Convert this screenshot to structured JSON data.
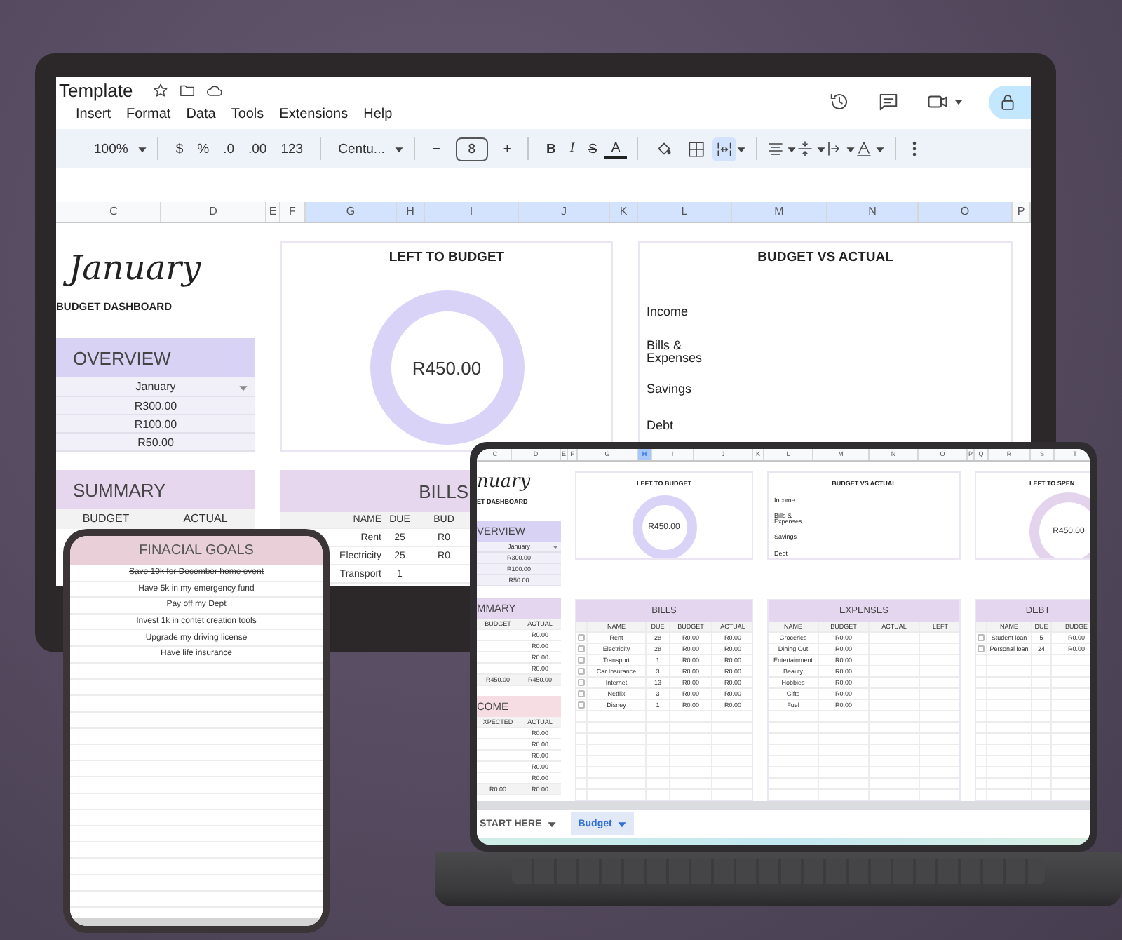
{
  "monitor": {
    "doc_title": "Template",
    "menu": [
      "Insert",
      "Format",
      "Data",
      "Tools",
      "Extensions",
      "Help"
    ],
    "toolbar": {
      "zoom": "100%",
      "currency": "$",
      "percent": "%",
      "fewer_decimals": ".0",
      "more_decimals": ".00",
      "number_format": "123",
      "font": "Centu...",
      "minus": "−",
      "font_size": "8",
      "plus": "+",
      "bold": "B",
      "italic": "I",
      "strikethrough": "S",
      "text_color": "A"
    },
    "columns": [
      {
        "label": "C",
        "selected": false
      },
      {
        "label": "D",
        "selected": false
      },
      {
        "label": "E",
        "selected": false
      },
      {
        "label": "F",
        "selected": false
      },
      {
        "label": "G",
        "selected": true
      },
      {
        "label": "H",
        "selected": true
      },
      {
        "label": "I",
        "selected": true
      },
      {
        "label": "J",
        "selected": true
      },
      {
        "label": "K",
        "selected": true
      },
      {
        "label": "L",
        "selected": true
      },
      {
        "label": "M",
        "selected": true
      },
      {
        "label": "N",
        "selected": true
      },
      {
        "label": "O",
        "selected": true
      },
      {
        "label": "P",
        "selected": false
      }
    ],
    "heading": "January",
    "subheading": "BUDGET DASHBOARD",
    "overview": {
      "title": "OVERVIEW",
      "month": "January",
      "values": [
        "R300.00",
        "R100.00",
        "R50.00"
      ]
    },
    "summary": {
      "title": "SUMMARY",
      "columns": [
        "BUDGET",
        "ACTUAL"
      ]
    },
    "left_to_budget": {
      "title": "LEFT TO BUDGET",
      "amount": "R450.00"
    },
    "budget_vs_actual": {
      "title": "BUDGET VS ACTUAL",
      "labels": [
        "Income",
        "Bills & Expenses",
        "Savings",
        "Debt"
      ]
    },
    "bills": {
      "title": "BILLS",
      "columns": [
        "NAME",
        "DUE",
        "BUD"
      ],
      "rows": [
        [
          "Rent",
          "25",
          "R0"
        ],
        [
          "Electricity",
          "25",
          "R0"
        ],
        [
          "Transport",
          "1"
        ]
      ]
    }
  },
  "tablet": {
    "title": "FINACIAL GOALS",
    "goals": [
      {
        "text": "Save 10k for December home event",
        "completed": true
      },
      {
        "text": "Have 5k in my emergency fund",
        "completed": false
      },
      {
        "text": "Pay off my Dept",
        "completed": false
      },
      {
        "text": "Invest 1k in contet creation tools",
        "completed": false
      },
      {
        "text": "Upgrade my driving license",
        "completed": false
      },
      {
        "text": "Have life insurance",
        "completed": false
      }
    ]
  },
  "laptop": {
    "columns": [
      {
        "label": "C",
        "selected": false
      },
      {
        "label": "D",
        "selected": false
      },
      {
        "label": "E",
        "selected": false
      },
      {
        "label": "F",
        "selected": false
      },
      {
        "label": "G",
        "selected": false
      },
      {
        "label": "H",
        "selected": true
      },
      {
        "label": "I",
        "selected": false
      },
      {
        "label": "J",
        "selected": false
      },
      {
        "label": "K",
        "selected": false
      },
      {
        "label": "L",
        "selected": false
      },
      {
        "label": "M",
        "selected": false
      },
      {
        "label": "N",
        "selected": false
      },
      {
        "label": "O",
        "selected": false
      },
      {
        "label": "P",
        "selected": false
      },
      {
        "label": "Q",
        "selected": false
      },
      {
        "label": "R",
        "selected": false
      },
      {
        "label": "S",
        "selected": false
      },
      {
        "label": "T",
        "selected": false
      }
    ],
    "heading": "nuary",
    "subheading": "ET DASHBOARD",
    "overview": {
      "title": "VERVIEW",
      "month": "January",
      "values": [
        "R300.00",
        "R100.00",
        "R50.00"
      ]
    },
    "summary": {
      "title": "MMARY",
      "columns": [
        "BUDGET",
        "ACTUAL"
      ],
      "rows": [
        "R0.00",
        "R0.00",
        "R0.00",
        "R0.00"
      ],
      "total": [
        "R450.00",
        "R450.00"
      ]
    },
    "income": {
      "title": "COME",
      "columns": [
        "XPECTED",
        "ACTUAL"
      ],
      "rows": [
        "R0.00",
        "R0.00",
        "R0.00",
        "R0.00",
        "R0.00"
      ],
      "total": [
        "R0.00",
        "R0.00"
      ]
    },
    "left_to_budget": {
      "title": "LEFT TO BUDGET",
      "amount": "R450.00"
    },
    "budget_vs_actual": {
      "title": "BUDGET VS ACTUAL",
      "labels": [
        "Income",
        "Bills & Expenses",
        "Savings",
        "Debt"
      ]
    },
    "left_to_spend": {
      "title": "LEFT TO SPEN",
      "amount": "R450.00"
    },
    "bills": {
      "title": "BILLS",
      "columns": [
        "NAME",
        "DUE",
        "BUDGET",
        "ACTUAL"
      ],
      "rows": [
        {
          "name": "Rent",
          "due": "28",
          "budget": "R0.00",
          "actual": "R0.00",
          "checked": false
        },
        {
          "name": "Electricity",
          "due": "28",
          "budget": "R0.00",
          "actual": "R0.00",
          "checked": false
        },
        {
          "name": "Transport",
          "due": "1",
          "budget": "R0.00",
          "actual": "R0.00",
          "checked": false
        },
        {
          "name": "Car Insurance",
          "due": "3",
          "budget": "R0.00",
          "actual": "R0.00",
          "checked": false
        },
        {
          "name": "Internet",
          "due": "13",
          "budget": "R0.00",
          "actual": "R0.00",
          "checked": false
        },
        {
          "name": "Netflix",
          "due": "3",
          "budget": "R0.00",
          "actual": "R0.00",
          "checked": false
        },
        {
          "name": "Disney",
          "due": "1",
          "budget": "R0.00",
          "actual": "R0.00",
          "checked": false
        }
      ]
    },
    "expenses": {
      "title": "EXPENSES",
      "columns": [
        "NAME",
        "BUDGET",
        "ACTUAL",
        "LEFT"
      ],
      "rows": [
        {
          "name": "Groceries",
          "budget": "R0.00"
        },
        {
          "name": "Dining Out",
          "budget": "R0.00"
        },
        {
          "name": "Entertainment",
          "budget": "R0.00"
        },
        {
          "name": "Beauty",
          "budget": "R0.00"
        },
        {
          "name": "Hobbies",
          "budget": "R0.00"
        },
        {
          "name": "Gifts",
          "budget": "R0.00"
        },
        {
          "name": "Fuel",
          "budget": "R0.00"
        }
      ]
    },
    "debt": {
      "title": "DEBT",
      "columns": [
        "NAME",
        "DUE",
        "BUDGE"
      ],
      "rows": [
        {
          "name": "Student loan",
          "due": "5",
          "budget": "R0.00",
          "checked": false
        },
        {
          "name": "Personal loan",
          "due": "24",
          "budget": "R0.00",
          "checked": false
        }
      ]
    },
    "sheet_tabs": [
      {
        "label": "START HERE",
        "selected": false
      },
      {
        "label": "Budget",
        "selected": true
      }
    ]
  }
}
